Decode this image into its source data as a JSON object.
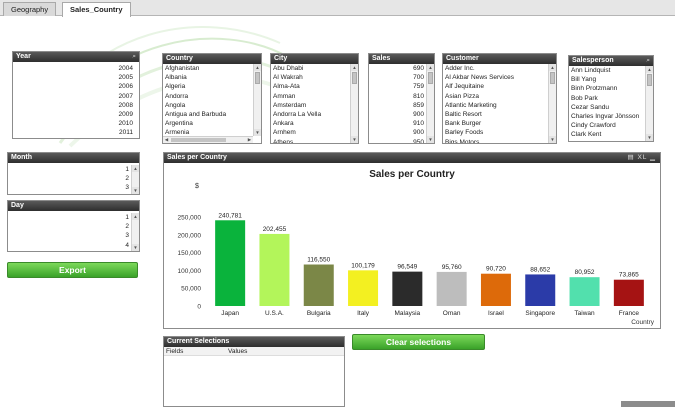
{
  "tabs": [
    {
      "label": "Geography",
      "active": false
    },
    {
      "label": "Sales_Country",
      "active": true
    }
  ],
  "year": {
    "title": "Year",
    "icon": "search-icon",
    "items": [
      "2004",
      "2005",
      "2006",
      "2007",
      "2008",
      "2009",
      "2010",
      "2011"
    ]
  },
  "country": {
    "title": "Country",
    "items": [
      "Afghanistan",
      "Albania",
      "Algeria",
      "Andorra",
      "Angola",
      "Antigua and Barbuda",
      "Argentina",
      "Armenia"
    ]
  },
  "city": {
    "title": "City",
    "items": [
      "Abu Dhabi",
      "Al Wakrah",
      "Alma-Ata",
      "Amman",
      "Amsterdam",
      "Andorra La Vella",
      "Ankara",
      "Arnhem",
      "Athens"
    ]
  },
  "sales": {
    "title": "Sales",
    "items": [
      "690",
      "700",
      "759",
      "810",
      "859",
      "900",
      "910",
      "900",
      "950"
    ]
  },
  "customer": {
    "title": "Customer",
    "items": [
      "Adder Inc.",
      "Al Akbar News Services",
      "Alf Jequitaine",
      "Asian Pizza",
      "Atlantic Marketing",
      "Baltic Resort",
      "Bank Burger",
      "Barley Foods",
      "Bigs Motors"
    ]
  },
  "salesperson": {
    "title": "Salesperson",
    "icon": "search-icon",
    "items": [
      "Ann Lindquist",
      "Bill Yang",
      "Binh Protzmann",
      "Bob Park",
      "Cezar Sandu",
      "Charles Ingvar Jönsson",
      "Cindy Crawford",
      "Clark Kent"
    ]
  },
  "month": {
    "title": "Month",
    "items": [
      "1",
      "2",
      "3"
    ]
  },
  "day": {
    "title": "Day",
    "items": [
      "1",
      "2",
      "3",
      "4"
    ]
  },
  "buttons": {
    "export": "Export",
    "clear": "Clear selections"
  },
  "current_selections": {
    "title": "Current Selections",
    "col_fields": "Fields",
    "col_values": "Values"
  },
  "chart_panel": {
    "header": "Sales per Country",
    "controls": "XL _"
  },
  "colors": {
    "header_dark": "#2e2e2e",
    "button_green": "#3aa229"
  },
  "chart_data": {
    "type": "bar",
    "title": "Sales per Country",
    "ylabel": "$",
    "xlabel": "Country",
    "ylim": [
      0,
      260000
    ],
    "yticks": [
      "250,000",
      "200,000",
      "150,000",
      "100,000",
      "50,000",
      "0"
    ],
    "ytick_values": [
      250000,
      200000,
      150000,
      100000,
      50000,
      0
    ],
    "categories": [
      "Japan",
      "U.S.A.",
      "Bulgaria",
      "Italy",
      "Malaysia",
      "Oman",
      "Israel",
      "Singapore",
      "Taiwan",
      "France"
    ],
    "values": [
      240781,
      202455,
      116550,
      100179,
      96549,
      95760,
      90720,
      88652,
      80952,
      73865
    ],
    "value_labels": [
      "240,781",
      "202,455",
      "116,550",
      "100,179",
      "96,549",
      "95,760",
      "90,720",
      "88,652",
      "80,952",
      "73,865"
    ],
    "bar_colors": [
      "#0ab33c",
      "#b3f55a",
      "#7b8747",
      "#f3f021",
      "#2b2b2b",
      "#bdbdbd",
      "#dd6a0a",
      "#2b3ba8",
      "#52e0ad",
      "#a51313"
    ]
  }
}
